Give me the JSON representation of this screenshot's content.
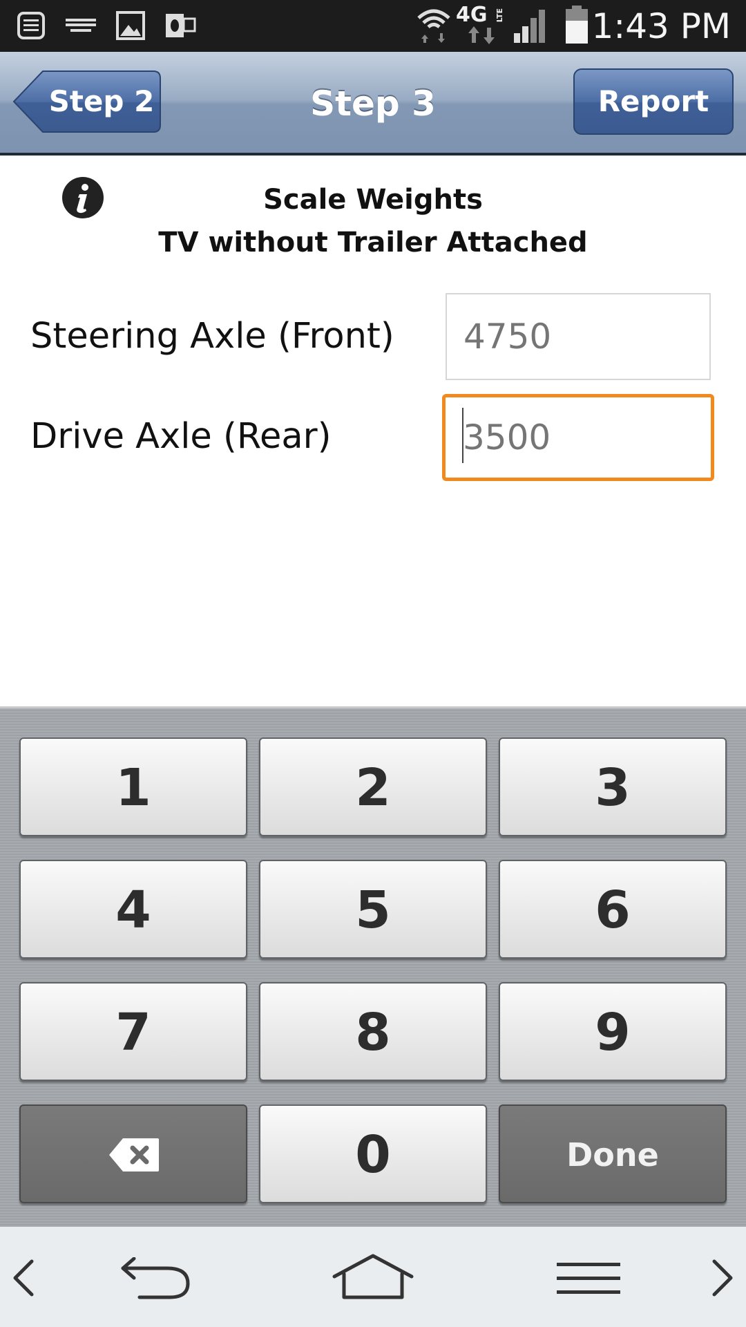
{
  "status_bar": {
    "icons": [
      "notification-list-icon",
      "keyboard-icon",
      "gallery-icon",
      "outlook-icon",
      "wifi-icon",
      "signal-icon",
      "battery-icon"
    ],
    "network": "4G",
    "network_sub": "LTE",
    "time": "1:43 PM"
  },
  "nav": {
    "back_label": "Step 2",
    "title": "Step 3",
    "report_label": "Report"
  },
  "content": {
    "heading_line1": "Scale Weights",
    "heading_line2": "TV without Trailer Attached",
    "fields": [
      {
        "label": "Steering Axle (Front)",
        "placeholder": "4750",
        "value": ""
      },
      {
        "label": "Drive Axle (Rear)",
        "placeholder": "3500",
        "value": ""
      }
    ]
  },
  "keypad": {
    "keys": [
      "1",
      "2",
      "3",
      "4",
      "5",
      "6",
      "7",
      "8",
      "9",
      "0"
    ],
    "done_label": "Done"
  },
  "colors": {
    "nav_blue": "#8298b4",
    "report_blue": "#4d6ea6",
    "focus_orange": "#f08a1f"
  }
}
